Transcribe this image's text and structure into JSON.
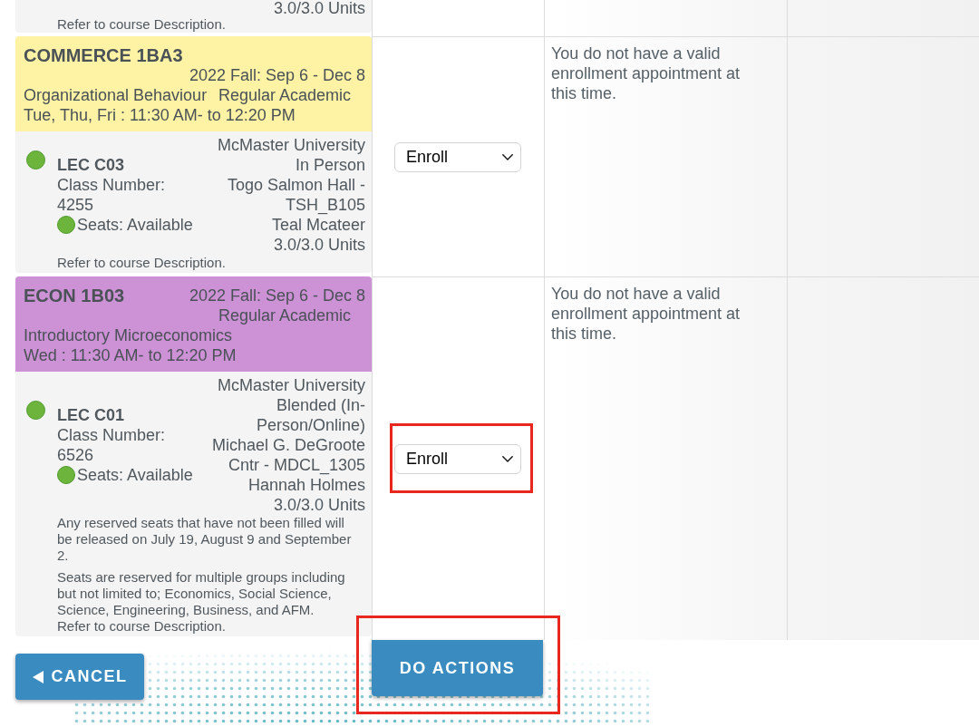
{
  "enrollment_table": {
    "rows": [
      {
        "course": {
          "section": {
            "units": "3.0/3.0 Units"
          },
          "description_note": "Refer to course Description."
        }
      },
      {
        "course": {
          "code": "COMMERCE 1BA3",
          "color": "#fef3a4",
          "term": "2022 Fall: Sep 6 - Dec 8",
          "session": "Regular Academic",
          "title": "Organizational Behaviour",
          "schedule": "Tue, Thu, Fri : 11:30 AM- to 12:20 PM",
          "section": {
            "open": true,
            "component": "LEC C03",
            "class_number": "Class Number: 4255",
            "seats_available": true,
            "seats": "Seats: Available",
            "campus": "McMaster University",
            "mode": "In Person",
            "location": "Togo Salmon Hall - TSH_B105",
            "instructor": "Teal Mcateer",
            "units": "3.0/3.0 Units"
          },
          "description_note": "Refer to course Description."
        },
        "action": {
          "value": "Enroll",
          "highlighted": false
        },
        "message": "You do not have a valid enrollment appointment at this time."
      },
      {
        "course": {
          "code": "ECON 1B03",
          "color": "#cd91d6",
          "term": "2022 Fall: Sep 6 - Dec 8",
          "session": "Regular Academic",
          "title": "Introductory Microeconomics",
          "schedule": "Wed : 11:30 AM- to 12:20 PM",
          "section": {
            "open": true,
            "component": "LEC C01",
            "class_number": "Class Number: 6526",
            "seats_available": true,
            "seats": "Seats: Available",
            "campus": "McMaster University",
            "mode": "Blended (In-Person/Online)",
            "location": "Michael G. DeGroote Cntr - MDCL_1305",
            "instructor": "Hannah Holmes",
            "units": "3.0/3.0 Units"
          },
          "notes": [
            "Any reserved seats that have not been filled will be released on July 19, August 9 and September 2.",
            "Seats are reserved for multiple groups including but not limited to; Economics, Social Science, Science, Engineering, Business, and AFM."
          ],
          "description_note": "Refer to course Description."
        },
        "action": {
          "value": "Enroll",
          "highlighted": true
        },
        "message": "You do not have a valid enrollment appointment at this time."
      }
    ]
  },
  "buttons": [
    {
      "kind": "back",
      "label": "CANCEL",
      "highlighted": false
    },
    {
      "kind": "submit",
      "label": "DO ACTIONS",
      "highlighted": true
    }
  ]
}
